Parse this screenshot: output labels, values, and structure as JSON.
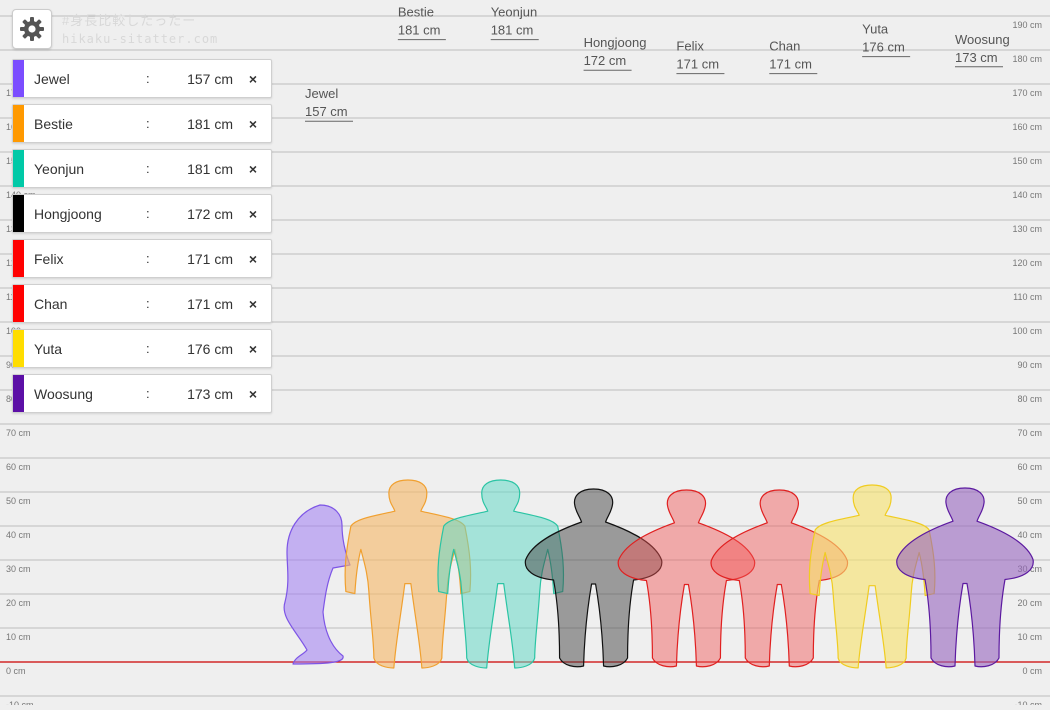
{
  "app": {
    "tagline": "#身長比較したったー",
    "site": "hikaku-sitatter.com"
  },
  "settings_icon": "gear-icon",
  "remove_icon": "close-icon",
  "colors": {
    "background": "#efefef",
    "grid": "#bdbdbd",
    "ground": "#cc0000"
  },
  "scale": {
    "unit": "cm",
    "min": -10,
    "max": 190,
    "step": 10,
    "left_labels_from": -10,
    "left_labels_to": 170
  },
  "people": [
    {
      "name": "Jewel",
      "height": 157,
      "height_text": "157 cm",
      "color": "#7b4dff",
      "fill": "rgba(158,123,242,0.55)",
      "stroke": "#7d55e6",
      "pose": "side"
    },
    {
      "name": "Bestie",
      "height": 181,
      "height_text": "181 cm",
      "color": "#ff9900",
      "fill": "rgba(246,184,105,0.62)",
      "stroke": "#f0a030",
      "pose": "front"
    },
    {
      "name": "Yeonjun",
      "height": 181,
      "height_text": "181 cm",
      "color": "#00c9a7",
      "fill": "rgba(102,216,198,0.55)",
      "stroke": "#2bc4a4",
      "pose": "front"
    },
    {
      "name": "Hongjoong",
      "height": 172,
      "height_text": "172 cm",
      "color": "#000000",
      "fill": "rgba(70,70,70,0.5)",
      "stroke": "#111111",
      "pose": "handsup"
    },
    {
      "name": "Felix",
      "height": 171,
      "height_text": "171 cm",
      "color": "#ff0000",
      "fill": "rgba(242,84,84,0.45)",
      "stroke": "#e02020",
      "pose": "handsup"
    },
    {
      "name": "Chan",
      "height": 171,
      "height_text": "171 cm",
      "color": "#ff0000",
      "fill": "rgba(242,84,84,0.45)",
      "stroke": "#e02020",
      "pose": "handsup"
    },
    {
      "name": "Yuta",
      "height": 176,
      "height_text": "176 cm",
      "color": "#ffdd00",
      "fill": "rgba(247,226,110,0.62)",
      "stroke": "#f0cc20",
      "pose": "front"
    },
    {
      "name": "Woosung",
      "height": 173,
      "height_text": "173 cm",
      "color": "#5c0fa6",
      "fill": "rgba(150,100,190,0.6)",
      "stroke": "#5c1aa0",
      "pose": "handsup"
    }
  ]
}
